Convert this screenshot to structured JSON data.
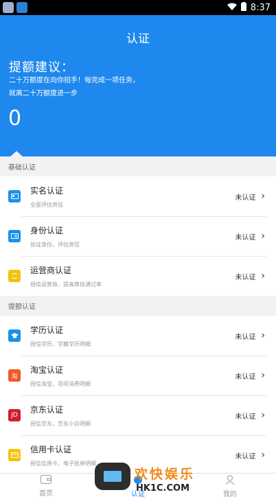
{
  "status_bar": {
    "time": "8:37"
  },
  "header": {
    "title": "认证",
    "subtitle": "提额建议：",
    "desc_line1": "二十万额度在向你招手！每完成一项任务，",
    "desc_line2": "就离二十万额度进一步",
    "amount": "0"
  },
  "sections": [
    {
      "label": "基础认证",
      "items": [
        {
          "title": "实名认证",
          "sub": "全面评估资信",
          "status": "未认证",
          "icon": "id-card-icon",
          "color": "#1a90e8"
        },
        {
          "title": "身份认证",
          "sub": "验证身份，评估资信",
          "status": "未认证",
          "icon": "profile-card-icon",
          "color": "#1a90e8"
        },
        {
          "title": "运营商认证",
          "sub": "授信运营商，提高审核通过率",
          "status": "未认证",
          "icon": "sync-icon",
          "color": "#f4c20d"
        }
      ]
    },
    {
      "label": "提额认证",
      "items": [
        {
          "title": "学历认证",
          "sub": "授信学历，学籍学历明细",
          "status": "未认证",
          "icon": "graduation-cap-icon",
          "color": "#1a90e8"
        },
        {
          "title": "淘宝认证",
          "sub": "授信淘宝，花呗消费明细",
          "status": "未认证",
          "icon": "taobao-icon",
          "color": "#f05a22",
          "glyph": "淘"
        },
        {
          "title": "京东认证",
          "sub": "授信京东，京东小白明细",
          "status": "未认证",
          "icon": "jd-icon",
          "color": "#d11e2e",
          "glyph": "JD"
        },
        {
          "title": "信用卡认证",
          "sub": "授信信用卡，电子账单明细",
          "status": "未认证",
          "icon": "credit-card-icon",
          "color": "#f4c20d"
        }
      ]
    }
  ],
  "bottom_nav": [
    {
      "label": "首页",
      "icon": "wallet-icon",
      "active": false
    },
    {
      "label": "认证",
      "icon": "certify-icon",
      "active": true
    },
    {
      "label": "我的",
      "icon": "person-icon",
      "active": false
    }
  ],
  "watermark": {
    "cn": "欢快娱乐",
    "en": "HK1C.COM"
  }
}
